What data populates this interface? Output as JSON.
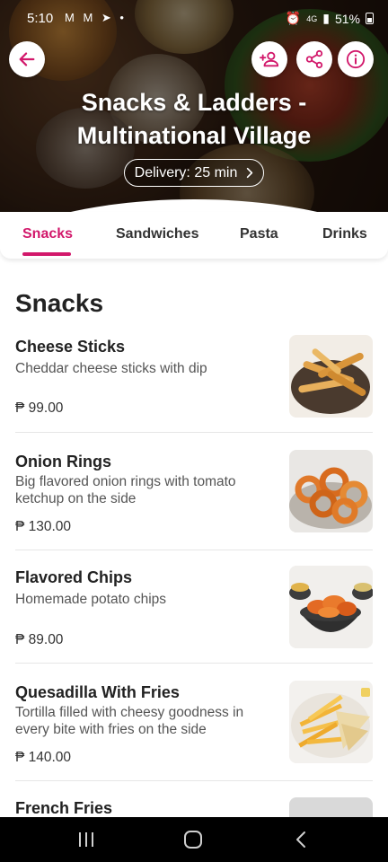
{
  "status_bar": {
    "time": "5:10",
    "left_icons": "M M ➤ •",
    "network": "4G",
    "battery": "51%"
  },
  "restaurant": {
    "name": "Snacks & Ladders - Multinational Village",
    "delivery": "Delivery: 25 min"
  },
  "tabs": [
    {
      "label": "Snacks",
      "active": true
    },
    {
      "label": "Sandwiches",
      "active": false
    },
    {
      "label": "Pasta",
      "active": false
    },
    {
      "label": "Drinks",
      "active": false
    }
  ],
  "section": {
    "title": "Snacks"
  },
  "items": [
    {
      "name": "Cheese Sticks",
      "description": "Cheddar cheese sticks with dip",
      "price": "₱ 99.00",
      "image": "cheese-sticks-photo"
    },
    {
      "name": "Onion Rings",
      "description": "Big flavored onion rings with tomato ketchup on the side",
      "price": "₱ 130.00",
      "image": "onion-rings-photo"
    },
    {
      "name": "Flavored Chips",
      "description": "Homemade potato chips",
      "price": "₱ 89.00",
      "image": "potato-chips-photo"
    },
    {
      "name": "Quesadilla With Fries",
      "description": "Tortilla filled with cheesy goodness in every bite with fries on the side",
      "price": "₱ 140.00",
      "image": "quesadilla-fries-photo"
    },
    {
      "name": "French Fries",
      "description": "",
      "price": "",
      "image": "french-fries-photo"
    }
  ],
  "colors": {
    "accent": "#d2186b",
    "text": "#222222",
    "muted": "#555555"
  },
  "icons": {
    "back": "arrow-left-icon",
    "group_order": "add-person-icon",
    "share": "share-icon",
    "info": "info-icon"
  }
}
